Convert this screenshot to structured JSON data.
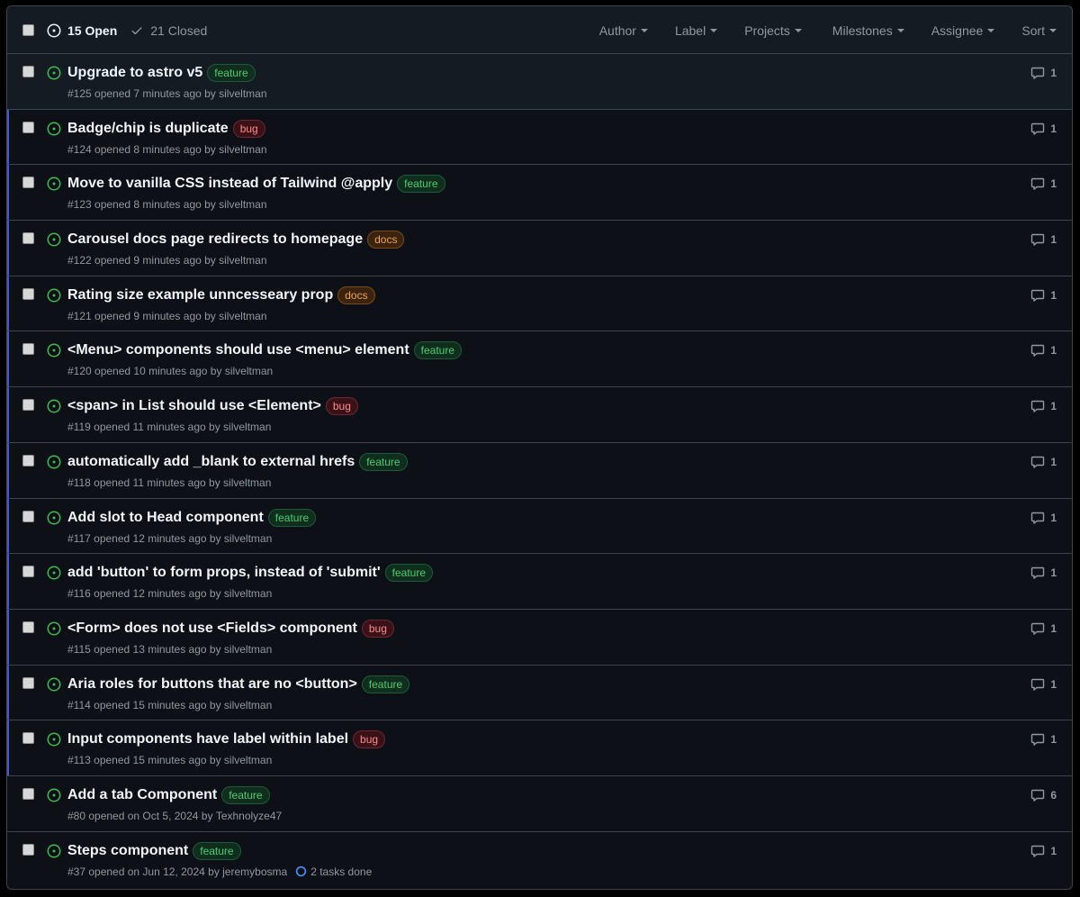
{
  "header": {
    "open_label": "15 Open",
    "closed_label": "21 Closed",
    "filters": [
      "Author",
      "Label",
      "Projects",
      "Milestones",
      "Assignee",
      "Sort"
    ]
  },
  "colors": {
    "open_green": "#3fb950",
    "accent_bar": "#4c52d6",
    "feature": "#4ecb71",
    "bug": "#ff8a8a",
    "docs": "#f0a04b"
  },
  "issues": [
    {
      "title": "Upgrade to astro v5",
      "label": "feature",
      "meta": "#125 opened 7 minutes ago by",
      "author": "silveltman",
      "comments": "1"
    },
    {
      "title": "Badge/chip is duplicate",
      "label": "bug",
      "meta": "#124 opened 8 minutes ago by",
      "author": "silveltman",
      "comments": "1"
    },
    {
      "title": "Move to vanilla CSS instead of Tailwind @apply",
      "label": "feature",
      "meta": "#123 opened 8 minutes ago by",
      "author": "silveltman",
      "comments": "1"
    },
    {
      "title": "Carousel docs page redirects to homepage",
      "label": "docs",
      "meta": "#122 opened 9 minutes ago by",
      "author": "silveltman",
      "comments": "1"
    },
    {
      "title": "Rating size example unncesseary prop",
      "label": "docs",
      "meta": "#121 opened 9 minutes ago by",
      "author": "silveltman",
      "comments": "1"
    },
    {
      "title": "<Menu> components should use <menu> element",
      "label": "feature",
      "meta": "#120 opened 10 minutes ago by",
      "author": "silveltman",
      "comments": "1"
    },
    {
      "title": "<span> in List should use <Element>",
      "label": "bug",
      "meta": "#119 opened 11 minutes ago by",
      "author": "silveltman",
      "comments": "1"
    },
    {
      "title": "automatically add _blank to external hrefs",
      "label": "feature",
      "meta": "#118 opened 11 minutes ago by",
      "author": "silveltman",
      "comments": "1"
    },
    {
      "title": "Add slot to Head component",
      "label": "feature",
      "meta": "#117 opened 12 minutes ago by",
      "author": "silveltman",
      "comments": "1"
    },
    {
      "title": "add 'button' to form props, instead of 'submit'",
      "label": "feature",
      "meta": "#116 opened 12 minutes ago by",
      "author": "silveltman",
      "comments": "1"
    },
    {
      "title": "<Form> does not use <Fields> component",
      "label": "bug",
      "meta": "#115 opened 13 minutes ago by",
      "author": "silveltman",
      "comments": "1"
    },
    {
      "title": "Aria roles for buttons that are no <button>",
      "label": "feature",
      "meta": "#114 opened 15 minutes ago by",
      "author": "silveltman",
      "comments": "1"
    },
    {
      "title": "Input components have label within label",
      "label": "bug",
      "meta": "#113 opened 15 minutes ago by",
      "author": "silveltman",
      "comments": "1"
    },
    {
      "title": "Add a tab Component",
      "label": "feature",
      "meta": "#80 opened on Oct 5, 2024 by",
      "author": "Texhnolyze47",
      "comments": "6"
    },
    {
      "title": "Steps component",
      "label": "feature",
      "meta": "#37 opened on Jun 12, 2024 by",
      "author": "jeremybosma",
      "comments": "1",
      "tasks": "2 tasks done"
    }
  ]
}
